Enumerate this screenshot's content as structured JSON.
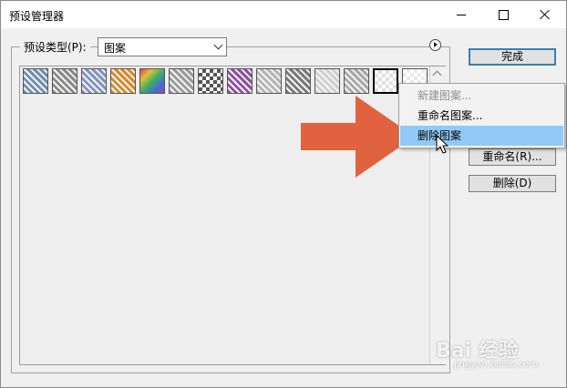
{
  "window": {
    "title": "预设管理器"
  },
  "preset": {
    "label": "预设类型(P):",
    "value": "图案"
  },
  "swatches": [
    {
      "icon": "pattern-bubbles-icon",
      "color": "#6f8fb0"
    },
    {
      "icon": "pattern-noise-gray-icon",
      "color": "#8a8a8a"
    },
    {
      "icon": "pattern-fabric-blue-icon",
      "color": "#8393c1"
    },
    {
      "icon": "pattern-orange-texture-icon",
      "color": "#d68a28"
    },
    {
      "icon": "pattern-rainbow-icon",
      "color": "#4aa86a"
    },
    {
      "icon": "pattern-stone-gray-icon",
      "color": "#9a9a9a"
    },
    {
      "icon": "pattern-checker-icon",
      "color": "#555555"
    },
    {
      "icon": "pattern-multicolor-icon",
      "color": "#9050a0"
    },
    {
      "icon": "pattern-cloud-gray-icon",
      "color": "#b5b5b5"
    },
    {
      "icon": "pattern-granite-icon",
      "color": "#7a7a7a"
    },
    {
      "icon": "pattern-zigzag-icon",
      "color": "#d0d0d0"
    },
    {
      "icon": "pattern-marble-icon",
      "color": "#a8a8a8"
    },
    {
      "icon": "pattern-transparent-icon",
      "color": "#e0e0e0"
    },
    {
      "icon": "pattern-transparent-icon",
      "color": "#eaeaea"
    }
  ],
  "buttons": {
    "done": "完成",
    "rename": "重命名(R)...",
    "delete": "删除(D)"
  },
  "context_menu": {
    "items": [
      {
        "label": "新建图案...",
        "state": "disabled"
      },
      {
        "label": "重命名图案...",
        "state": "normal"
      },
      {
        "label": "删除图案",
        "state": "highlighted"
      }
    ]
  },
  "annotation": {
    "arrow_color": "#e0623e"
  },
  "watermark": {
    "main": "Bai 经验",
    "sub": "jingyan.baidu.com"
  }
}
